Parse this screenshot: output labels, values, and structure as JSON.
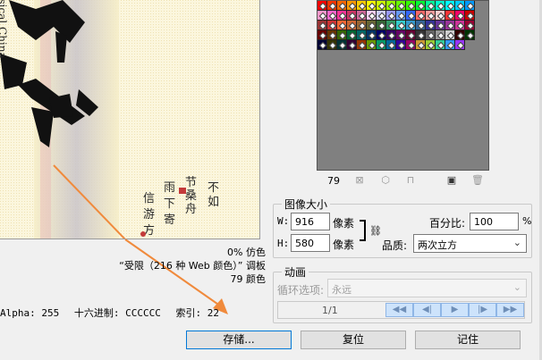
{
  "preview": {
    "vertical_text": "ssical China",
    "calligraphy_chars": "国风"
  },
  "palette_info": {
    "dither_label": "0% 仿色",
    "palette_label": "“受限（216 种 Web 颜色）” 调板",
    "colors_label": "79 颜色"
  },
  "status_bar": {
    "alpha": "Alpha: 255",
    "hex": "十六进制: CCCCCC",
    "index": "索引: 22"
  },
  "color_table": {
    "count": "79",
    "icons": [
      "map-transparent-icon",
      "web-shift-icon",
      "lock-icon",
      "new-color-icon",
      "delete-icon"
    ]
  },
  "image_size": {
    "title": "图像大小",
    "width_label": "W:",
    "width_value": "916",
    "width_unit": "像素",
    "height_label": "H:",
    "height_value": "580",
    "height_unit": "像素",
    "percent_label": "百分比:",
    "percent_value": "100",
    "percent_unit": "%",
    "quality_label": "品质:",
    "quality_value": "两次立方"
  },
  "animation": {
    "title": "动画",
    "loop_label": "循环选项:",
    "loop_value": "永远",
    "frame_counter": "1/1",
    "controls": [
      "◀◀",
      "◀|",
      "▶",
      "|▶",
      "▶▶"
    ]
  },
  "buttons": {
    "save": "存储...",
    "reset": "复位",
    "remember": "记住"
  },
  "colors": {
    "accent": "#0078d7",
    "arrow": "#f08a3c",
    "preview_bg": "#fbf6dd"
  }
}
